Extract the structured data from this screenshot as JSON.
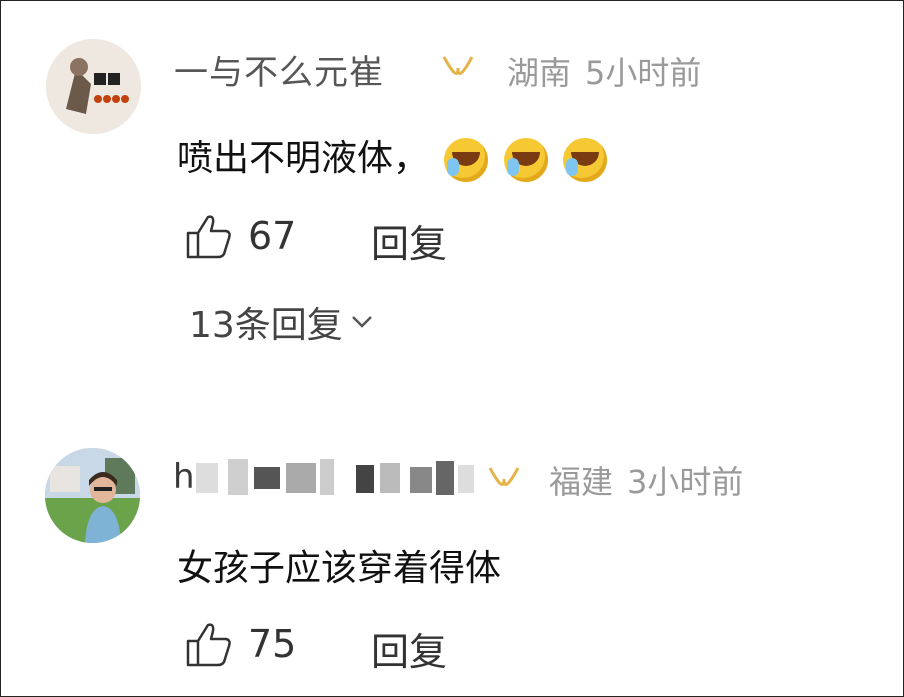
{
  "comments": [
    {
      "username": "一与不么元崔",
      "location": "湖南",
      "time": "5小时前",
      "text": "喷出不明液体，",
      "likes": "67",
      "reply_label": "回复",
      "more_replies": "13条回复",
      "avatar_icon": "cartoon-sticker-avatar",
      "badge_icon": "vip-badge-icon"
    },
    {
      "username": "h",
      "location": "福建",
      "time": "3小时前",
      "text": "女孩子应该穿着得体",
      "likes": "75",
      "reply_label": "回复",
      "avatar_icon": "photo-avatar",
      "badge_icon": "vip-badge-icon"
    }
  ],
  "colors": {
    "badge": "#e4b44a",
    "meta": "#9a9a9a",
    "text": "#111111"
  }
}
